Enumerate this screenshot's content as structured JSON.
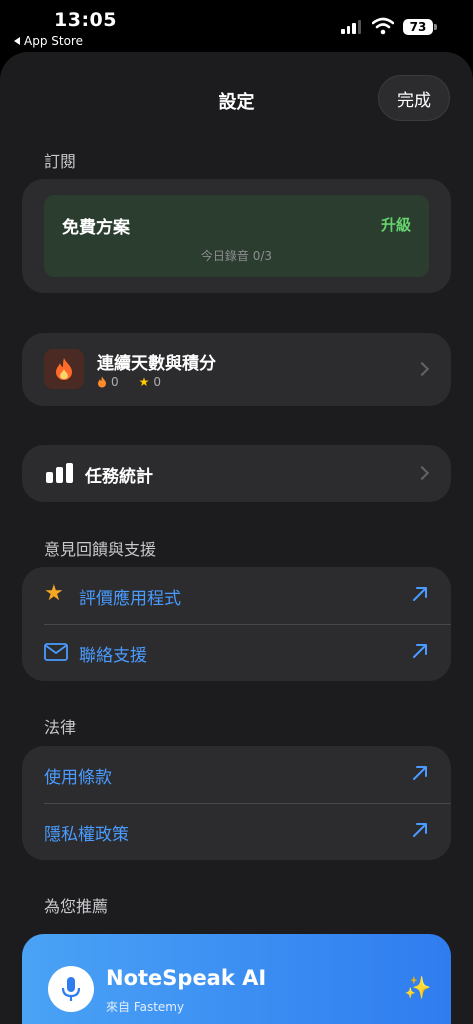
{
  "status_bar": {
    "time": "13:05",
    "back_app": "App Store",
    "battery": "73"
  },
  "nav": {
    "title": "設定",
    "done": "完成"
  },
  "subscription": {
    "header": "訂閱",
    "plan_name": "免費方案",
    "upgrade": "升級",
    "usage": "今日錄音 0/3"
  },
  "streak": {
    "title": "連續天數與積分",
    "streak_count": "0",
    "points": "0"
  },
  "stats": {
    "title": "任務統計"
  },
  "feedback": {
    "header": "意見回饋與支援",
    "items": [
      {
        "label": "評價應用程式",
        "icon": "star-icon"
      },
      {
        "label": "聯絡支援",
        "icon": "envelope-icon"
      }
    ]
  },
  "legal": {
    "header": "法律",
    "items": [
      {
        "label": "使用條款"
      },
      {
        "label": "隱私權政策"
      }
    ]
  },
  "recommended": {
    "header": "為您推薦",
    "app_name": "NoteSpeak AI",
    "developer": "來自 Fastemy"
  },
  "colors": {
    "accent_blue": "#4a9bff",
    "upgrade_green": "#65d36e",
    "plan_bg": "#2b3d2f"
  }
}
